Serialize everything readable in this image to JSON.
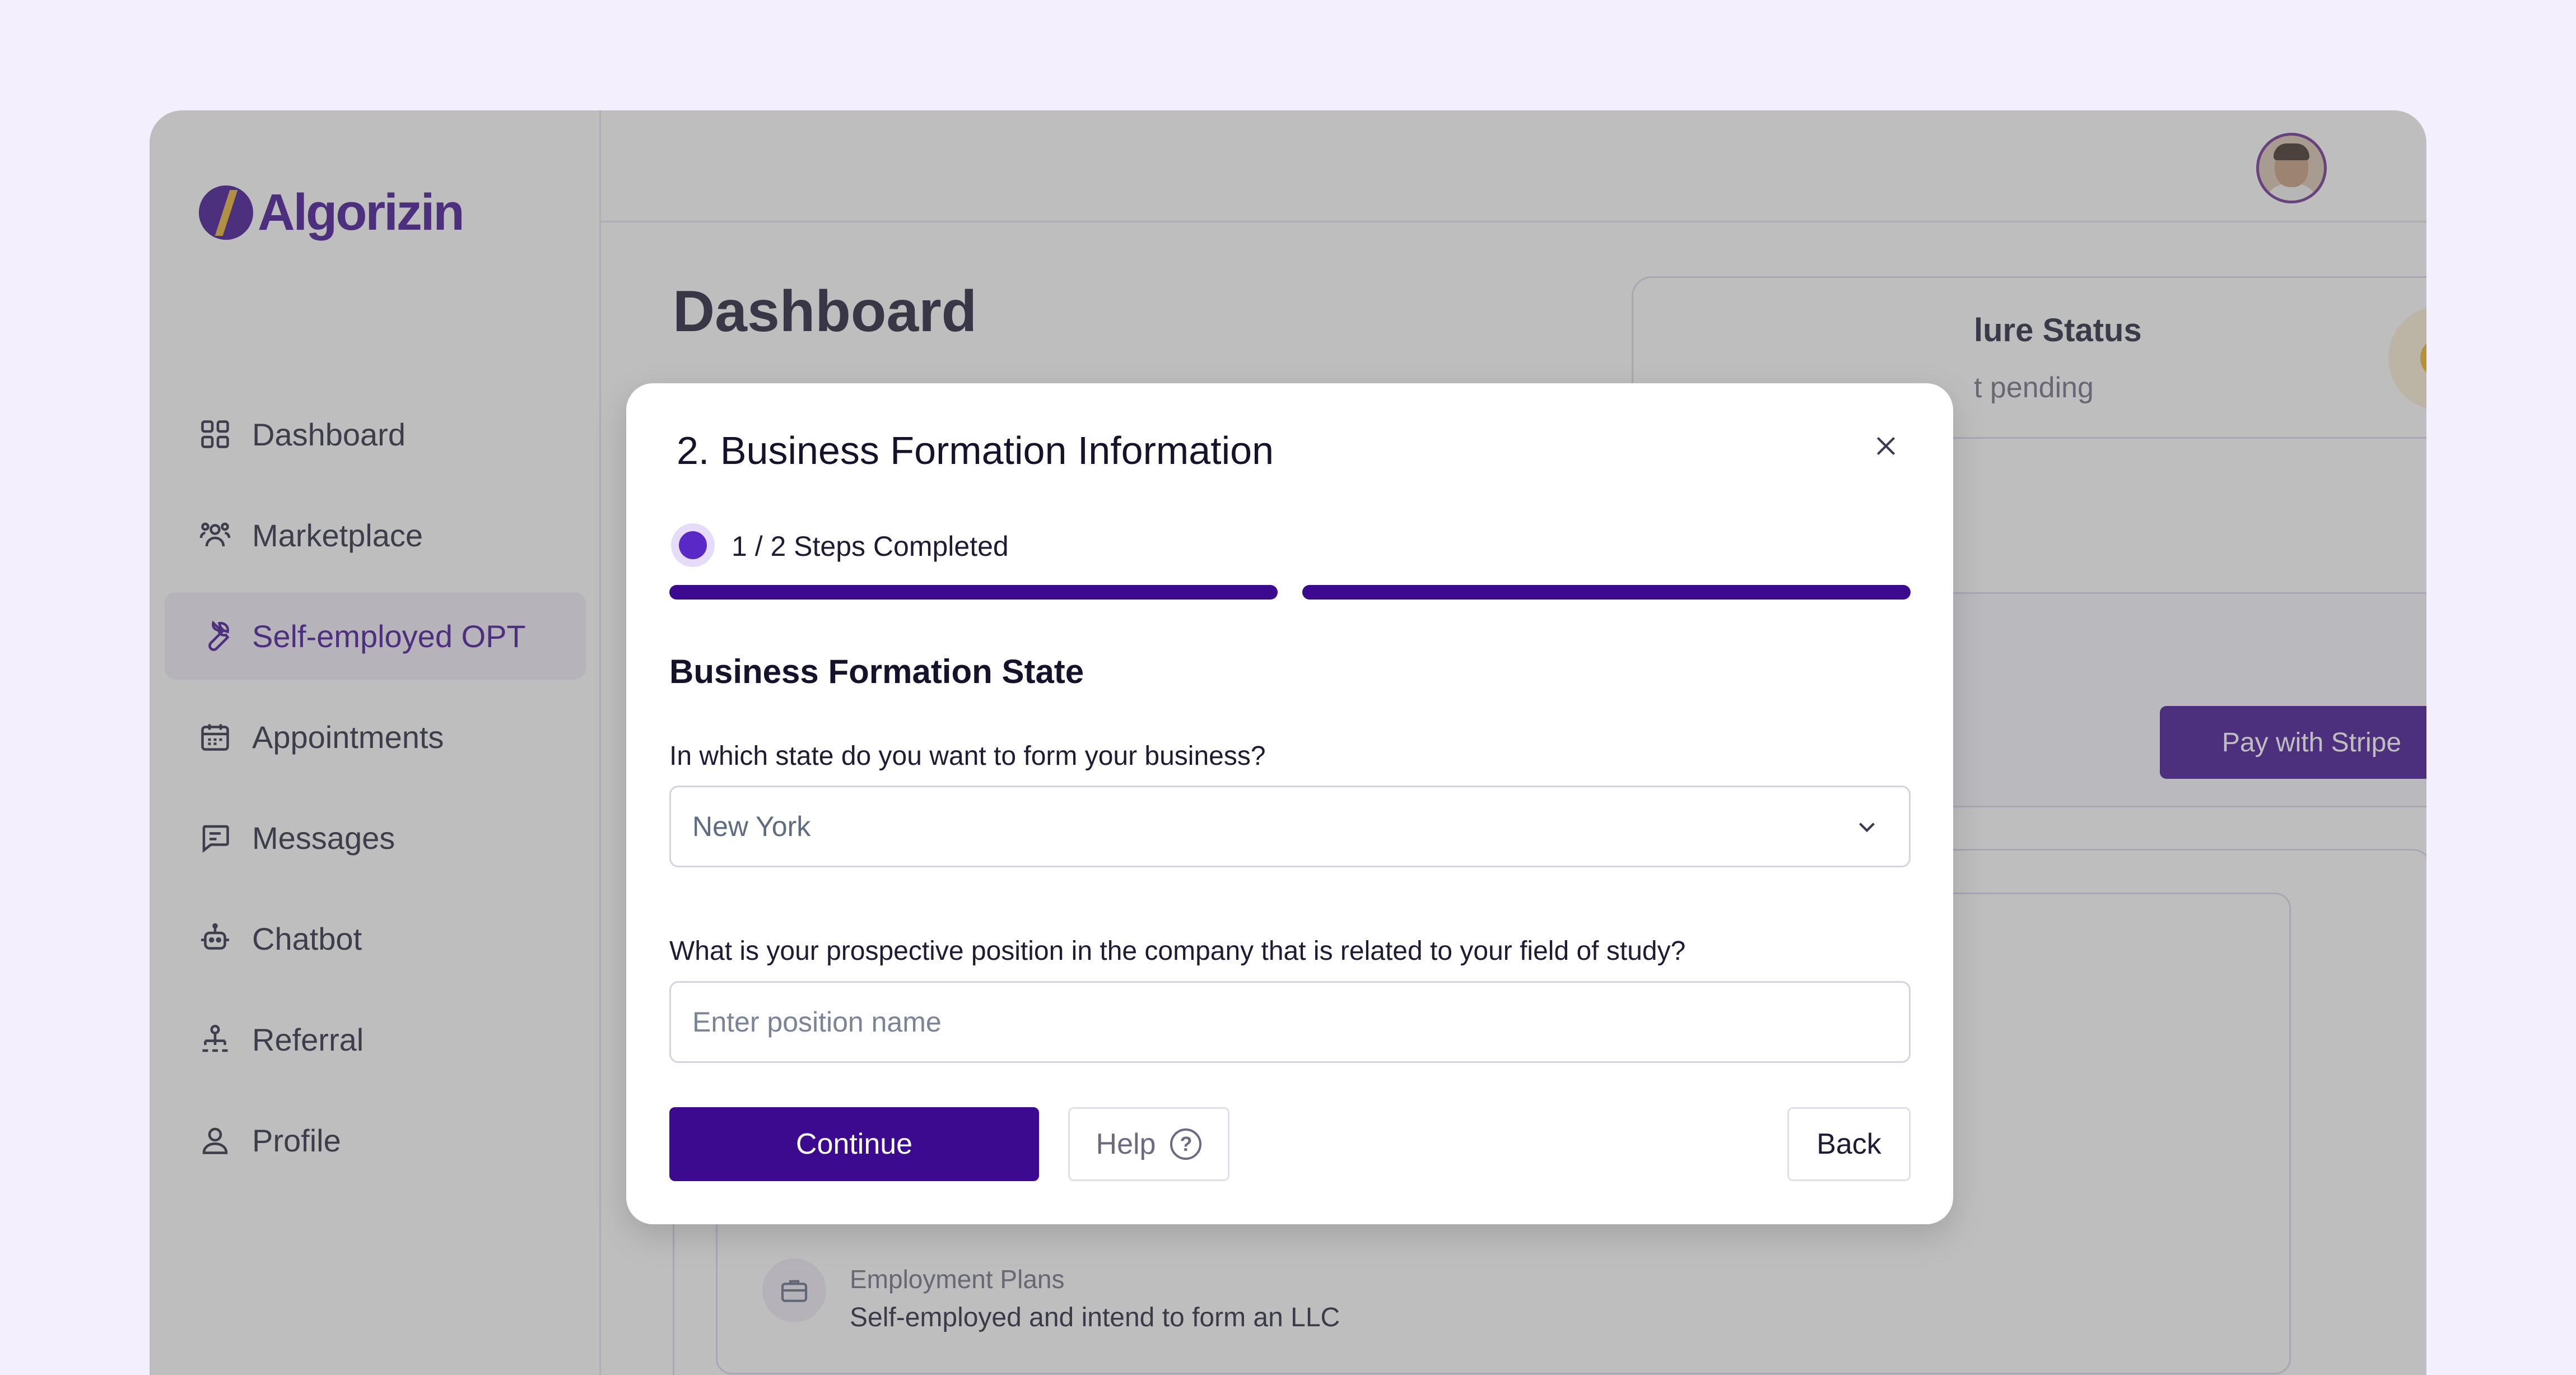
{
  "brand": {
    "name": "Algorizin"
  },
  "sidebar": {
    "items": [
      {
        "label": "Dashboard",
        "icon": "grid-icon",
        "active": false
      },
      {
        "label": "Marketplace",
        "icon": "people-icon",
        "active": false
      },
      {
        "label": "Self-employed OPT",
        "icon": "wrench-icon",
        "active": true
      },
      {
        "label": "Appointments",
        "icon": "calendar-icon",
        "active": false
      },
      {
        "label": "Messages",
        "icon": "message-icon",
        "active": false
      },
      {
        "label": "Chatbot",
        "icon": "robot-icon",
        "active": false
      },
      {
        "label": "Referral",
        "icon": "referral-icon",
        "active": false
      },
      {
        "label": "Profile",
        "icon": "user-icon",
        "active": false
      }
    ]
  },
  "header": {
    "title": "Dashboard"
  },
  "background": {
    "status_title": "lure Status",
    "status_sub": "t pending",
    "stripe_button": "Pay with Stripe",
    "employment_label": "Employment Plans",
    "employment_value": "Self-employed and intend to form an LLC"
  },
  "modal": {
    "title": "2.  Business Formation Information",
    "steps_text": "1 / 2  Steps Completed",
    "steps_completed": 1,
    "steps_total": 2,
    "section_title": "Business Formation State",
    "q_state": "In which state do you want to form your business?",
    "state_value": "New York",
    "q_position": "What is your prospective position in the company that is related to your field of study?",
    "position_placeholder": "Enter position name",
    "continue_label": "Continue",
    "help_label": "Help",
    "back_label": "Back"
  },
  "colors": {
    "brand_purple": "#3b0a8f",
    "accent_yellow": "#f3b117",
    "page_bg": "#f4effd"
  }
}
